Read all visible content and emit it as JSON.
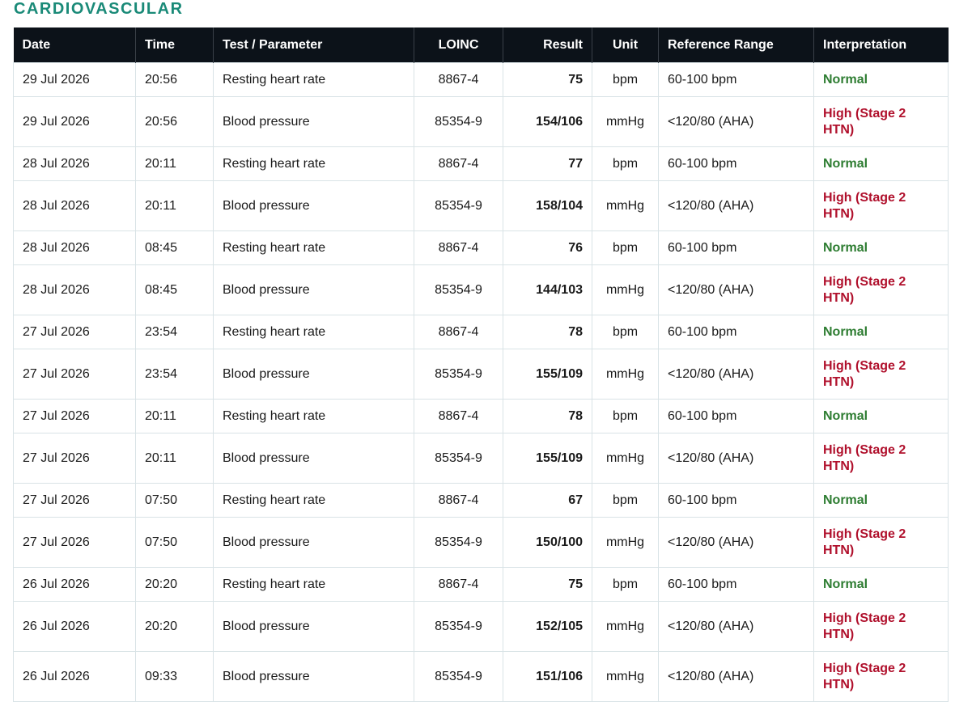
{
  "section_title": "CARDIOVASCULAR",
  "colors": {
    "normal": "#2e7d32",
    "high": "#b0102c",
    "heading": "#1a8a78",
    "header_bg": "#0c1219"
  },
  "columns": [
    "Date",
    "Time",
    "Test / Parameter",
    "LOINC",
    "Result",
    "Unit",
    "Reference Range",
    "Interpretation"
  ],
  "rows": [
    {
      "date": "29 Jul 2026",
      "time": "20:56",
      "test": "Resting heart rate",
      "loinc": "8867-4",
      "result": "75",
      "unit": "bpm",
      "range": "60-100 bpm",
      "interp": "Normal",
      "status": "normal"
    },
    {
      "date": "29 Jul 2026",
      "time": "20:56",
      "test": "Blood pressure",
      "loinc": "85354-9",
      "result": "154/106",
      "unit": "mmHg",
      "range": "<120/80 (AHA)",
      "interp": "High (Stage 2 HTN)",
      "status": "high"
    },
    {
      "date": "28 Jul 2026",
      "time": "20:11",
      "test": "Resting heart rate",
      "loinc": "8867-4",
      "result": "77",
      "unit": "bpm",
      "range": "60-100 bpm",
      "interp": "Normal",
      "status": "normal"
    },
    {
      "date": "28 Jul 2026",
      "time": "20:11",
      "test": "Blood pressure",
      "loinc": "85354-9",
      "result": "158/104",
      "unit": "mmHg",
      "range": "<120/80 (AHA)",
      "interp": "High (Stage 2 HTN)",
      "status": "high"
    },
    {
      "date": "28 Jul 2026",
      "time": "08:45",
      "test": "Resting heart rate",
      "loinc": "8867-4",
      "result": "76",
      "unit": "bpm",
      "range": "60-100 bpm",
      "interp": "Normal",
      "status": "normal"
    },
    {
      "date": "28 Jul 2026",
      "time": "08:45",
      "test": "Blood pressure",
      "loinc": "85354-9",
      "result": "144/103",
      "unit": "mmHg",
      "range": "<120/80 (AHA)",
      "interp": "High (Stage 2 HTN)",
      "status": "high"
    },
    {
      "date": "27 Jul 2026",
      "time": "23:54",
      "test": "Resting heart rate",
      "loinc": "8867-4",
      "result": "78",
      "unit": "bpm",
      "range": "60-100 bpm",
      "interp": "Normal",
      "status": "normal"
    },
    {
      "date": "27 Jul 2026",
      "time": "23:54",
      "test": "Blood pressure",
      "loinc": "85354-9",
      "result": "155/109",
      "unit": "mmHg",
      "range": "<120/80 (AHA)",
      "interp": "High (Stage 2 HTN)",
      "status": "high"
    },
    {
      "date": "27 Jul 2026",
      "time": "20:11",
      "test": "Resting heart rate",
      "loinc": "8867-4",
      "result": "78",
      "unit": "bpm",
      "range": "60-100 bpm",
      "interp": "Normal",
      "status": "normal"
    },
    {
      "date": "27 Jul 2026",
      "time": "20:11",
      "test": "Blood pressure",
      "loinc": "85354-9",
      "result": "155/109",
      "unit": "mmHg",
      "range": "<120/80 (AHA)",
      "interp": "High (Stage 2 HTN)",
      "status": "high"
    },
    {
      "date": "27 Jul 2026",
      "time": "07:50",
      "test": "Resting heart rate",
      "loinc": "8867-4",
      "result": "67",
      "unit": "bpm",
      "range": "60-100 bpm",
      "interp": "Normal",
      "status": "normal"
    },
    {
      "date": "27 Jul 2026",
      "time": "07:50",
      "test": "Blood pressure",
      "loinc": "85354-9",
      "result": "150/100",
      "unit": "mmHg",
      "range": "<120/80 (AHA)",
      "interp": "High (Stage 2 HTN)",
      "status": "high"
    },
    {
      "date": "26 Jul 2026",
      "time": "20:20",
      "test": "Resting heart rate",
      "loinc": "8867-4",
      "result": "75",
      "unit": "bpm",
      "range": "60-100 bpm",
      "interp": "Normal",
      "status": "normal"
    },
    {
      "date": "26 Jul 2026",
      "time": "20:20",
      "test": "Blood pressure",
      "loinc": "85354-9",
      "result": "152/105",
      "unit": "mmHg",
      "range": "<120/80 (AHA)",
      "interp": "High (Stage 2 HTN)",
      "status": "high"
    },
    {
      "date": "26 Jul 2026",
      "time": "09:33",
      "test": "Blood pressure",
      "loinc": "85354-9",
      "result": "151/106",
      "unit": "mmHg",
      "range": "<120/80 (AHA)",
      "interp": "High (Stage 2 HTN)",
      "status": "high"
    }
  ]
}
